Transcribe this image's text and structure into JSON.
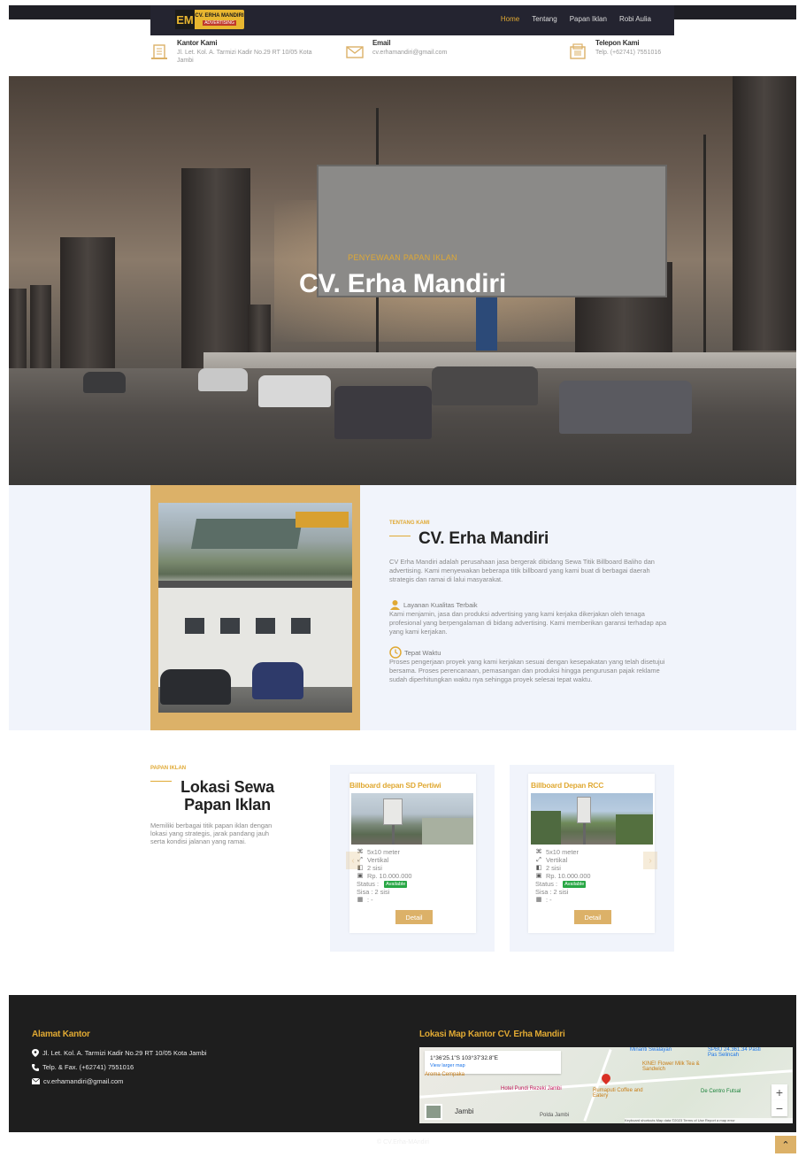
{
  "brand": {
    "logo_line1": "CV. ERHA MANDIRI",
    "logo_line2": "ADVERTISING",
    "logo_mark": "EM"
  },
  "nav": {
    "items": [
      "Home",
      "Tentang",
      "Papan Iklan",
      "Robi Aulia"
    ],
    "active": "Home"
  },
  "contact": [
    {
      "icon": "office-building-icon",
      "title": "Kantor Kami",
      "text": "Jl. Let. Kol. A. Tarmizi Kadir No.29 RT 10/05 Kota Jambi"
    },
    {
      "icon": "envelope-icon",
      "title": "Email",
      "text": "cv.erhamandiri@gmail.com"
    },
    {
      "icon": "fax-phone-icon",
      "title": "Telepon Kami",
      "text": "Telp. (+62741) 7551016"
    }
  ],
  "hero": {
    "subtitle": "PENYEWAAN PAPAN IKLAN",
    "title": "CV. Erha Mandiri"
  },
  "about": {
    "kicker": "TENTANG KAMI",
    "title": "CV. Erha Mandiri",
    "intro": "CV Erha Mandiri adalah perusahaan jasa bergerak dibidang Sewa Titik Billboard Baliho dan advertising. Kami menyewakan beberapa titik billboard yang kami buat di berbagai daerah strategis dan ramai di lalui masyarakat.",
    "features": [
      {
        "icon": "worker-icon",
        "title": "Layanan Kualitas Terbaik",
        "text": "Kami menjamin, jasa dan produksi advertising yang kami kerjaka dikerjakan oleh tenaga profesional yang berpengalaman di bidang advertising. Kami memberikan garansi terhadap apa yang kami kerjakan."
      },
      {
        "icon": "clock-icon",
        "title": "Tepat Waktu",
        "text": "Proses pengerjaan proyek yang kami kerjakan sesuai dengan kesepakatan yang telah disetujui bersama. Proses perencanaan, pemasangan dan produksi hingga pengurusan pajak reklame sudah diperhitungkan waktu nya sehingga proyek selesai tepat waktu."
      }
    ]
  },
  "billboards": {
    "kicker": "PAPAN IKLAN",
    "title": "Lokasi Sewa Papan Iklan",
    "description": "Memiliki berbagai titik papan iklan dengan lokasi yang strategis, jarak pandang jauh serta kondisi jalanan yang ramai.",
    "items": [
      {
        "name": "Billboard depan SD Pertiwi",
        "size": "5x10 meter",
        "orientation": "Vertikal",
        "sides": "2 sisi",
        "price": "Rp. 10.000.000",
        "status_label": "Status :",
        "status": "Available",
        "remaining": "Sisa : 2 sisi",
        "calendar": ": -",
        "button": "Detail"
      },
      {
        "name": "Billboard Depan RCC",
        "size": "5x10 meter",
        "orientation": "Vertikal",
        "sides": "2 sisi",
        "price": "Rp. 10.000.000",
        "status_label": "Status :",
        "status": "Available",
        "remaining": "Sisa : 2 sisi",
        "calendar": ": -",
        "button": "Detail"
      }
    ],
    "prev": "‹",
    "next": "›"
  },
  "footer": {
    "address_heading": "Alamat Kantor",
    "address": "Jl. Let. Kol. A. Tarmizi Kadir No.29 RT 10/05 Kota Jambi",
    "phone": "Telp. & Fax. (+62741) 7551016",
    "email": "cv.erhamandiri@gmail.com",
    "map_heading": "Lokasi Map Kantor CV. Erha Mandiri",
    "map": {
      "coords": "1°36'25.1\"S 103°37'32.8\"E",
      "larger_map": "View larger map",
      "labels": [
        "Aroma Cempaka",
        "Hotel Pundi Rezeki Jambi",
        "Rumaputi Coffee and Eatery",
        "KINE! Flower Milk Tea & Sandwich",
        "De Centro Futsal",
        "Jambi",
        "Polda Jambi",
        "Minanti Swalayan",
        "SPBU 24.361.34 Pasti Pas Selincah"
      ],
      "zoom_in": "+",
      "zoom_out": "−",
      "attribution": "Keyboard shortcuts  Map data ©2023  Terms of Use  Report a map error"
    },
    "copyright": "© CV.Erha-MAndiri",
    "to_top": "⌃"
  },
  "colors": {
    "accent": "#e0a933",
    "dark": "#1e1e1e",
    "light_bg": "#f1f4fb",
    "frame": "#dcb168"
  }
}
